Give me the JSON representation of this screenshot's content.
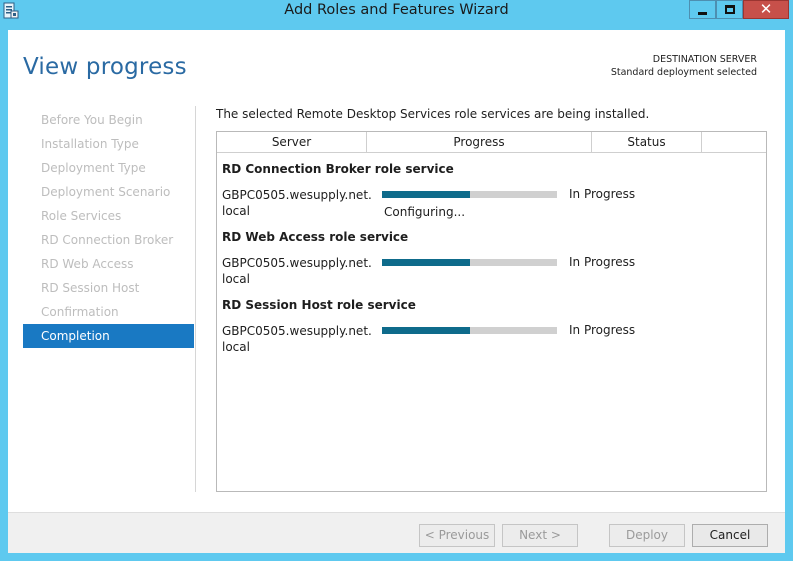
{
  "window": {
    "title": "Add Roles and Features Wizard",
    "close_symbol": "✕"
  },
  "header": {
    "page_title": "View progress",
    "destination_label": "DESTINATION SERVER",
    "destination_value": "Standard deployment selected"
  },
  "nav": {
    "items": [
      {
        "label": "Before You Begin"
      },
      {
        "label": "Installation Type"
      },
      {
        "label": "Deployment Type"
      },
      {
        "label": "Deployment Scenario"
      },
      {
        "label": "Role Services"
      },
      {
        "label": "RD Connection Broker"
      },
      {
        "label": "RD Web Access"
      },
      {
        "label": "RD Session Host"
      },
      {
        "label": "Confirmation"
      },
      {
        "label": "Completion"
      }
    ],
    "active_index": 9
  },
  "main": {
    "intro": "The selected Remote Desktop Services role services are being installed.",
    "columns": [
      "Server",
      "Progress",
      "Status",
      ""
    ],
    "groups": [
      {
        "title": "RD Connection Broker role service",
        "server": "GBPC0505.wesupply.net.local",
        "progress": 0.5,
        "status": "In Progress",
        "detail": "Configuring..."
      },
      {
        "title": "RD Web Access role service",
        "server": "GBPC0505.wesupply.net.local",
        "progress": 0.5,
        "status": "In Progress",
        "detail": ""
      },
      {
        "title": "RD Session Host role service",
        "server": "GBPC0505.wesupply.net.local",
        "progress": 0.5,
        "status": "In Progress",
        "detail": ""
      }
    ]
  },
  "footer": {
    "previous_label": "< Previous",
    "next_label": "Next >",
    "deploy_label": "Deploy",
    "cancel_label": "Cancel"
  },
  "colors": {
    "accent": "#1979c3",
    "progress_fill": "#0e6b8b",
    "title_blue": "#2a6aa3",
    "frame": "#5ec9ef"
  }
}
